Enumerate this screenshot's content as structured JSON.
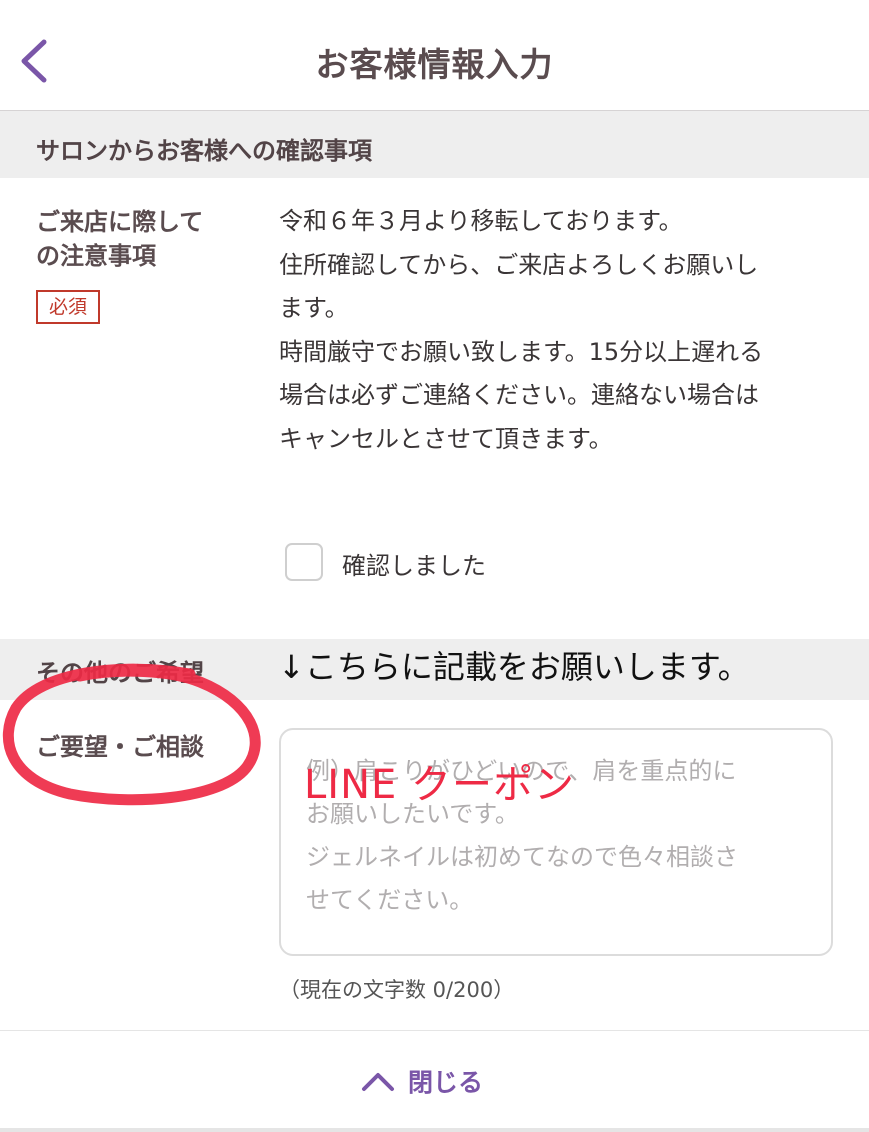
{
  "header": {
    "title": "お客様情報入力",
    "back_icon": "chevron-left-icon"
  },
  "salon_section": {
    "title": "サロンからお客様への確認事項",
    "notice_label_line1": "ご来店に際して",
    "notice_label_line2": "の注意事項",
    "required_badge": "必須",
    "notice_lines": [
      "令和６年３月より移転しております。",
      "住所確認してから、ご来店よろしくお願いし",
      "ます。",
      "時間厳守でお願い致します。15分以上遅れる",
      "場合は必ずご連絡ください。連絡ない場合は",
      "キャンセルとさせて頂きます。"
    ],
    "confirm_checkbox_label": "確認しました",
    "confirm_checked": false
  },
  "other_section": {
    "title": "その他のご希望",
    "request_label": "ご要望・ご相談",
    "placeholder_lines": [
      "例）肩こりがひどいので、肩を重点的に",
      "お願いしたいです。",
      "ジェルネイルは初めてなので色々相談さ",
      "せてください。"
    ],
    "char_count": "（現在の文字数 0/200）"
  },
  "annotations": {
    "arrow_note": "↓こちらに記載をお願いします。",
    "coupon_note": "LINE クーポン"
  },
  "footer": {
    "close_label": "閉じる",
    "close_icon": "chevron-up-icon"
  },
  "colors": {
    "accent": "#7a56a8",
    "required": "#c0392b",
    "annotation_red": "#ee2a45",
    "section_bg": "#eeeeee"
  }
}
